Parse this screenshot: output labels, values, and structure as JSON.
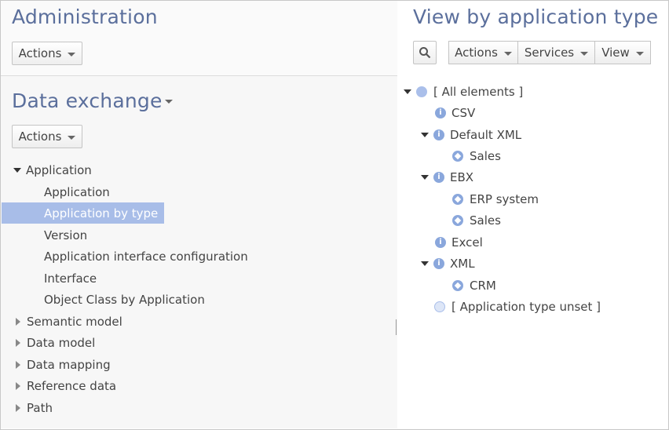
{
  "left": {
    "admin_title": "Administration",
    "admin_actions": "Actions",
    "data_exchange_title": "Data exchange",
    "data_exchange_actions": "Actions",
    "nav": {
      "application_group": "Application",
      "children": [
        "Application",
        "Application by type",
        "Version",
        "Application interface configuration",
        "Interface",
        "Object Class by Application"
      ],
      "collapsed_groups": [
        "Semantic model",
        "Data model",
        "Data mapping",
        "Reference data",
        "Path"
      ]
    }
  },
  "right": {
    "title": "View by application type",
    "toolbar": {
      "actions": "Actions",
      "services": "Services",
      "view": "View"
    },
    "tree": {
      "root": "[ All elements ]",
      "csv": "CSV",
      "default_xml": "Default XML",
      "default_xml_sales": "Sales",
      "ebx": "EBX",
      "ebx_erp": "ERP system",
      "ebx_sales": "Sales",
      "excel": "Excel",
      "xml": "XML",
      "xml_crm": "CRM",
      "unset": "[ Application type unset ]"
    }
  },
  "colors": {
    "title": "#5b6f9c",
    "selection": "#a8bde8",
    "node_icon": "#8aa7dc"
  }
}
